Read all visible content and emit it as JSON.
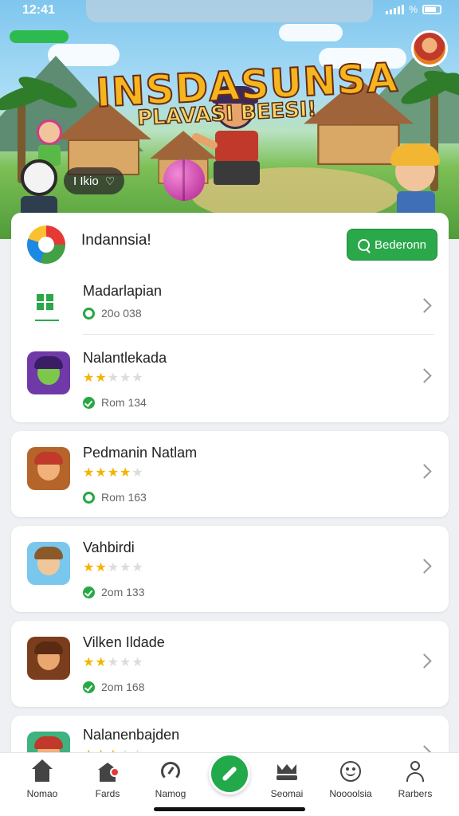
{
  "status_bar": {
    "time": "12:41",
    "battery_text": "%"
  },
  "hero": {
    "title": "INSDASUNSA",
    "subtitle": "PLAVASI BEESI!",
    "like_badge": "I Ikio",
    "progress": 1.0
  },
  "featured": {
    "title": "Indannsia!",
    "cta_label": "Bederonn",
    "items": [
      {
        "title": "Madarlapian",
        "meta": "20o 038",
        "meta_icon": "ring-icon",
        "rating": null
      },
      {
        "title": "Nalantlekada",
        "meta": "Rom 134",
        "meta_icon": "check-icon",
        "rating": 2
      }
    ]
  },
  "cards": [
    {
      "title": "Pedmanin Natlam",
      "meta": "Rom 163",
      "meta_icon": "ring-icon",
      "rating": 4
    },
    {
      "title": "Vahbirdi",
      "meta": "2om 133",
      "meta_icon": "check-icon",
      "rating": 2
    },
    {
      "title": "Vilken Ildade",
      "meta": "2om 168",
      "meta_icon": "check-icon",
      "rating": 2
    },
    {
      "title": "Nalanenbajden",
      "meta": "",
      "meta_icon": "",
      "rating": 3
    }
  ],
  "bottom_nav": {
    "items": [
      {
        "label": "Nomao",
        "icon": "home-icon"
      },
      {
        "label": "Fards",
        "icon": "store-icon"
      },
      {
        "label": "Namog",
        "icon": "gauge-icon"
      },
      {
        "label": "Seomai",
        "icon": "crown-icon"
      },
      {
        "label": "Noooolsia",
        "icon": "smiley-icon"
      },
      {
        "label": "Rarbers",
        "icon": "profile-icon"
      }
    ],
    "fab_icon": "pen-icon"
  },
  "colors": {
    "accent": "#2aa84a",
    "star": "#f4b400"
  }
}
